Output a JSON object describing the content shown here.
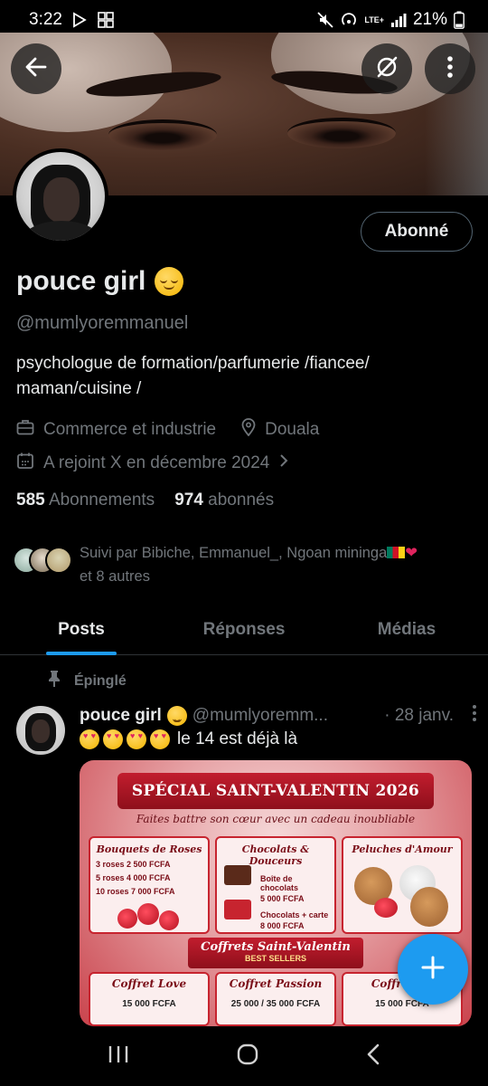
{
  "status_bar": {
    "time": "3:22",
    "network": "LTE+",
    "battery": "21%"
  },
  "header": {
    "back_icon": "arrow-left-icon",
    "grok_icon": "grok-icon",
    "more_icon": "more-vertical-icon"
  },
  "profile": {
    "display_name": "pouce girl",
    "handle": "@mumlyoremmanuel",
    "follow_button_label": "Abonné",
    "bio": "psychologue de formation/parfumerie /fiancee/ maman/cuisine /",
    "category": "Commerce et industrie",
    "location": "Douala",
    "joined": "A rejoint X en décembre 2024",
    "following_count": "585",
    "following_label": "Abonnements",
    "followers_count": "974",
    "followers_label": "abonnés",
    "followed_by": "Suivi par Bibiche, Emmanuel_, Ngoan mininga",
    "followed_by_more": "et 8 autres"
  },
  "tabs": [
    {
      "label": "Posts",
      "active": true
    },
    {
      "label": "Réponses",
      "active": false
    },
    {
      "label": "Médias",
      "active": false
    }
  ],
  "pinned_post": {
    "pinned_label": "Épinglé",
    "author": "pouce girl",
    "handle": "@mumlyoremm...",
    "time": "· 28 janv.",
    "text": "le 14 est déjà là",
    "image": {
      "title": "SPÉCIAL SAINT-VALENTIN 2026",
      "subtitle": "Faites battre son cœur avec un cadeau inoubliable",
      "card1_title": "Bouquets de Roses",
      "card1_lines": [
        "3 roses  2 500 FCFA",
        "5 roses  4 000 FCFA",
        "10 roses  7 000 FCFA"
      ],
      "card2_title": "Chocolats & Douceurs",
      "card2_lines": [
        "Boîte de chocolats",
        "5 000 FCFA",
        "Chocolats + carte",
        "8 000 FCFA"
      ],
      "card3_title": "Peluches d'Amour",
      "ribbon_title": "Coffrets Saint-Valentin",
      "ribbon_sub": "BEST SELLERS",
      "coffret1_title": "Coffret Love",
      "coffret1_price": "15 000 FCFA",
      "coffret2_title": "Coffret Passion",
      "coffret2_price": "25 000 / 35 000 FCFA",
      "coffret3_title": "Coffret Lu",
      "coffret3_price": "15 000 FCFA"
    }
  },
  "colors": {
    "accent": "#1d9bf0",
    "text_primary": "#e7e9ea",
    "text_secondary": "#71767b",
    "background": "#000000"
  }
}
